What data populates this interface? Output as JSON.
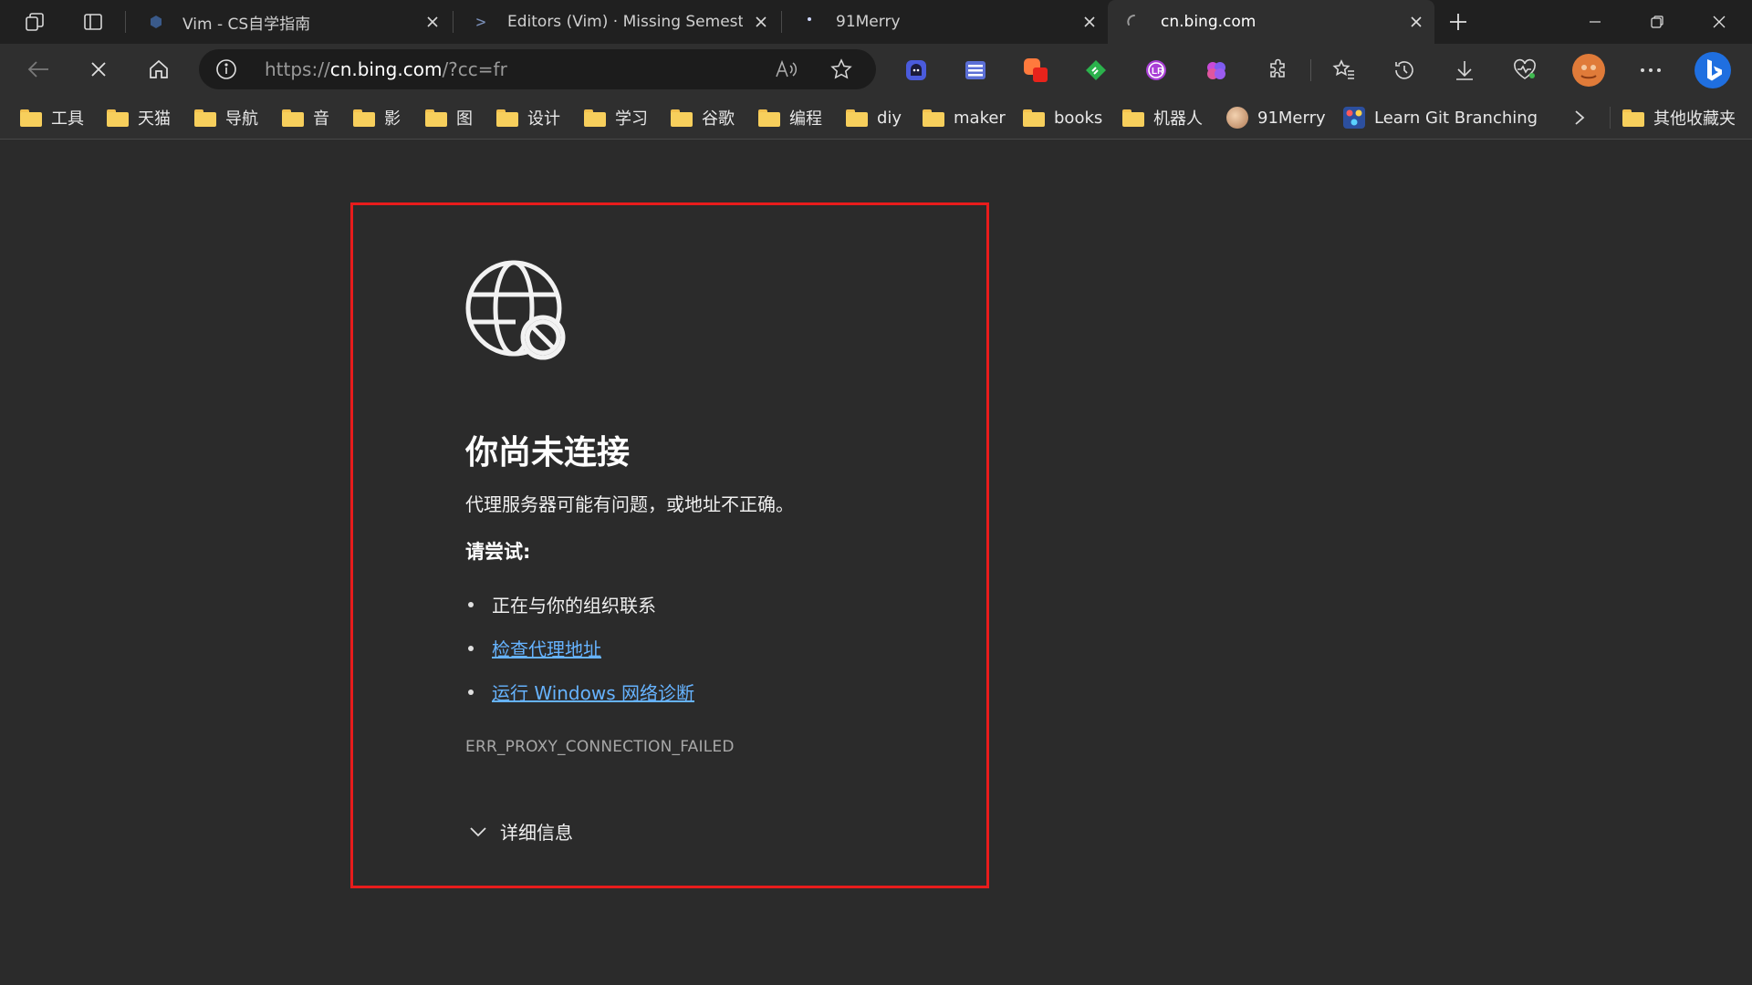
{
  "tabs": [
    {
      "title": "Vim - CS自学指南",
      "favicon": "cube-icon",
      "active": false
    },
    {
      "title": "Editors (Vim) · Missing Semester",
      "favicon": "terminal-prompt-icon",
      "active": false
    },
    {
      "title": "91Merry",
      "favicon": "dot-icon",
      "active": false
    },
    {
      "title": "cn.bing.com",
      "favicon": "loading-spinner-icon",
      "active": true
    }
  ],
  "address": {
    "scheme": "https://",
    "host": "cn.bing.com",
    "path": "/?cc=fr"
  },
  "bookmarks": [
    {
      "label": "工具",
      "type": "folder"
    },
    {
      "label": "天猫",
      "type": "folder"
    },
    {
      "label": "导航",
      "type": "folder"
    },
    {
      "label": "音",
      "type": "folder"
    },
    {
      "label": "影",
      "type": "folder"
    },
    {
      "label": "图",
      "type": "folder"
    },
    {
      "label": "设计",
      "type": "folder"
    },
    {
      "label": "学习",
      "type": "folder"
    },
    {
      "label": "谷歌",
      "type": "folder"
    },
    {
      "label": "编程",
      "type": "folder"
    },
    {
      "label": "diy",
      "type": "folder"
    },
    {
      "label": "maker",
      "type": "folder"
    },
    {
      "label": "books",
      "type": "folder"
    },
    {
      "label": "机器人",
      "type": "folder"
    },
    {
      "label": "91Merry",
      "type": "site"
    },
    {
      "label": "Learn Git Branching",
      "type": "site"
    }
  ],
  "other_bookmarks": "其他收藏夹",
  "error": {
    "title": "你尚未连接",
    "description": "代理服务器可能有问题，或地址不正确。",
    "try_heading": "请尝试:",
    "suggestions": [
      {
        "text": "正在与你的组织联系",
        "link": false
      },
      {
        "text": "检查代理地址",
        "link": true
      },
      {
        "text": "运行 Windows 网络诊断",
        "link": true
      }
    ],
    "code": "ERR_PROXY_CONNECTION_FAILED",
    "details_label": "详细信息"
  },
  "colors": {
    "highlight_border": "#e81c1c",
    "link": "#66b3ff",
    "folder": "#f7cf5c"
  }
}
